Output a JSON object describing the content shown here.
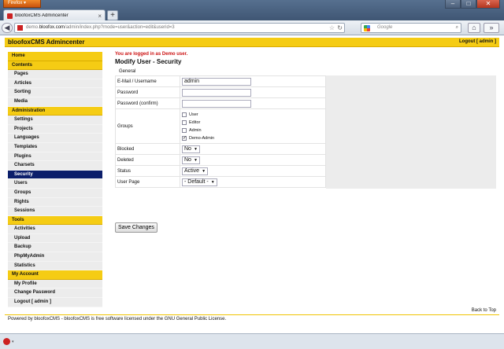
{
  "browser": {
    "app_button": "Firefox",
    "tab_title": "bloofoxCMS Admincenter",
    "url_prefix": "demo.",
    "url_host": "bloofox.com",
    "url_path": "/admin/index.php?mode=user&action=edit&userid=3",
    "search_placeholder": "Google"
  },
  "header": {
    "brand": "bloofoxCMS Admincenter",
    "logout": "Logout [ admin ]"
  },
  "sidebar": [
    {
      "label": "Home",
      "kind": "head"
    },
    {
      "label": "Contents",
      "kind": "head"
    },
    {
      "label": "Pages",
      "kind": "item"
    },
    {
      "label": "Articles",
      "kind": "item"
    },
    {
      "label": "Sorting",
      "kind": "item"
    },
    {
      "label": "Media",
      "kind": "item"
    },
    {
      "label": "Administration",
      "kind": "head"
    },
    {
      "label": "Settings",
      "kind": "item"
    },
    {
      "label": "Projects",
      "kind": "item"
    },
    {
      "label": "Languages",
      "kind": "item"
    },
    {
      "label": "Templates",
      "kind": "item"
    },
    {
      "label": "Plugins",
      "kind": "item"
    },
    {
      "label": "Charsets",
      "kind": "item"
    },
    {
      "label": "Security",
      "kind": "active"
    },
    {
      "label": "Users",
      "kind": "item"
    },
    {
      "label": "Groups",
      "kind": "item"
    },
    {
      "label": "Rights",
      "kind": "item"
    },
    {
      "label": "Sessions",
      "kind": "item"
    },
    {
      "label": "Tools",
      "kind": "head"
    },
    {
      "label": "Activities",
      "kind": "item"
    },
    {
      "label": "Upload",
      "kind": "item"
    },
    {
      "label": "Backup",
      "kind": "item"
    },
    {
      "label": "PhpMyAdmin",
      "kind": "item"
    },
    {
      "label": "Statistics",
      "kind": "item"
    },
    {
      "label": "My Account",
      "kind": "head"
    },
    {
      "label": "My Profile",
      "kind": "item"
    },
    {
      "label": "Change Password",
      "kind": "item"
    },
    {
      "label": "Logout [ admin ]",
      "kind": "item"
    }
  ],
  "main": {
    "notice": "You are logged in as Demo user.",
    "title": "Modify User - Security",
    "legend": "General",
    "fields": {
      "email_label": "E-Mail / Username",
      "email_value": "admin",
      "password_label": "Password",
      "password_confirm_label": "Password (confirm)",
      "groups_label": "Groups",
      "groups": [
        {
          "label": "User",
          "checked": false
        },
        {
          "label": "Editor",
          "checked": false
        },
        {
          "label": "Admin",
          "checked": false
        },
        {
          "label": "Demo-Admin",
          "checked": true
        }
      ],
      "blocked_label": "Blocked",
      "blocked_value": "No",
      "deleted_label": "Deleted",
      "deleted_value": "No",
      "status_label": "Status",
      "status_value": "Active",
      "userpage_label": "User Page",
      "userpage_value": "- Default -"
    },
    "save_label": "Save Changes"
  },
  "footer": {
    "back_to_top": "Back to Top",
    "text": "Powered by bloofoxCMS - bloofoxCMS is free software licensed under the GNU General Public License."
  }
}
